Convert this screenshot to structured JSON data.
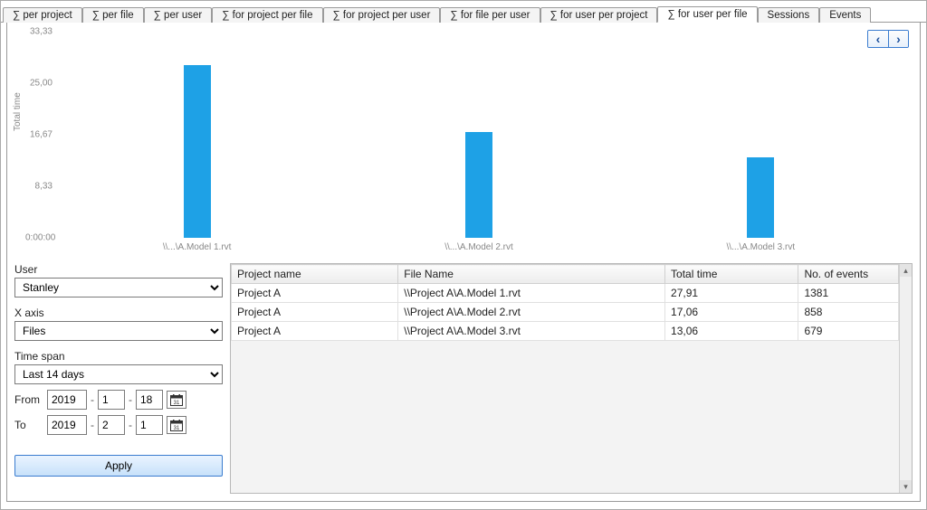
{
  "tabs": [
    {
      "label": "∑ per project"
    },
    {
      "label": "∑ per file"
    },
    {
      "label": "∑ per user"
    },
    {
      "label": "∑ for project per file"
    },
    {
      "label": "∑ for project per user"
    },
    {
      "label": "∑ for file per user"
    },
    {
      "label": "∑ for user per project"
    },
    {
      "label": "∑ for user per file"
    },
    {
      "label": "Sessions"
    },
    {
      "label": "Events"
    }
  ],
  "active_tab_index": 7,
  "nav": {
    "prev": "‹",
    "next": "›"
  },
  "chart_axis": {
    "y_label": "Total time",
    "y_ticks": [
      "33,33",
      "25,00",
      "16,67",
      "8,33",
      "0:00:00"
    ]
  },
  "chart_data": {
    "type": "bar",
    "ylabel": "Total time",
    "ylim": [
      0,
      33.33
    ],
    "categories": [
      "\\\\...\\A.Model 1.rvt",
      "\\\\...\\A.Model 2.rvt",
      "\\\\...\\A.Model 3.rvt"
    ],
    "values": [
      27.91,
      17.06,
      13.06
    ]
  },
  "controls": {
    "user_label": "User",
    "user_value": "Stanley",
    "xaxis_label": "X axis",
    "xaxis_value": "Files",
    "timespan_label": "Time span",
    "timespan_value": "Last 14 days",
    "from_label": "From",
    "to_label": "To",
    "from": {
      "y": "2019",
      "m": "1",
      "d": "18"
    },
    "to": {
      "y": "2019",
      "m": "2",
      "d": "1"
    },
    "apply_label": "Apply"
  },
  "table": {
    "columns": [
      "Project name",
      "File Name",
      "Total time",
      "No. of events"
    ],
    "rows": [
      {
        "project": "Project A",
        "file": "\\\\Project A\\A.Model 1.rvt",
        "time": "27,91",
        "events": "1381"
      },
      {
        "project": "Project A",
        "file": "\\\\Project A\\A.Model 2.rvt",
        "time": "17,06",
        "events": "858"
      },
      {
        "project": "Project A",
        "file": "\\\\Project A\\A.Model 3.rvt",
        "time": "13,06",
        "events": "679"
      }
    ]
  }
}
